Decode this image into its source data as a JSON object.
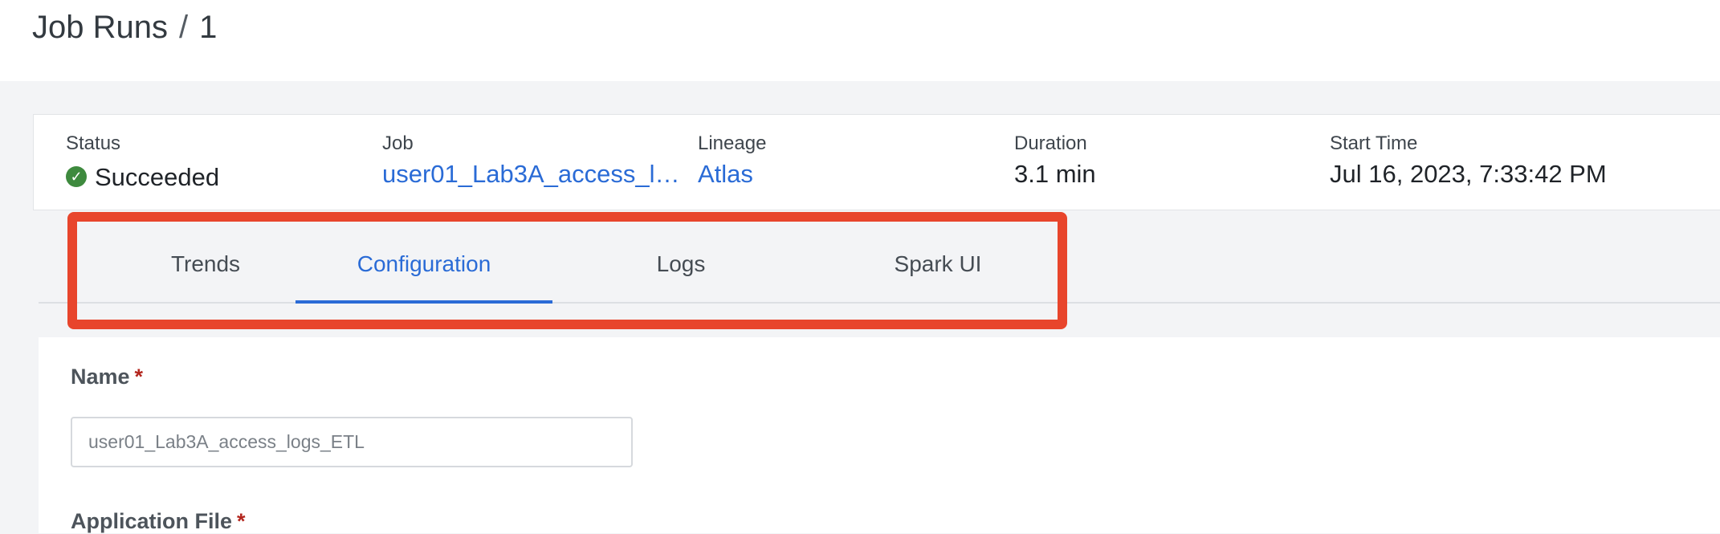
{
  "breadcrumb": {
    "parent": "Job Runs",
    "separator": "/",
    "current": "1"
  },
  "summary": {
    "status": {
      "label": "Status",
      "value": "Succeeded",
      "icon": "check-circle-icon",
      "color": "#3e8a3e"
    },
    "job": {
      "label": "Job",
      "value": "user01_Lab3A_access_logs_ETL"
    },
    "lineage": {
      "label": "Lineage",
      "value": "Atlas"
    },
    "duration": {
      "label": "Duration",
      "value": "3.1 min"
    },
    "start_time": {
      "label": "Start Time",
      "value": "Jul 16, 2023, 7:33:42 PM"
    }
  },
  "tabs": [
    {
      "label": "Trends",
      "active": false
    },
    {
      "label": "Configuration",
      "active": true
    },
    {
      "label": "Logs",
      "active": false
    },
    {
      "label": "Spark UI",
      "active": false
    }
  ],
  "form": {
    "name_label": "Name",
    "name_value": "user01_Lab3A_access_logs_ETL",
    "app_file_label": "Application File",
    "required_marker": "*"
  },
  "colors": {
    "accent": "#2a6bd6",
    "highlight": "#e8452c",
    "success": "#3e8a3e",
    "required": "#b3261e"
  }
}
